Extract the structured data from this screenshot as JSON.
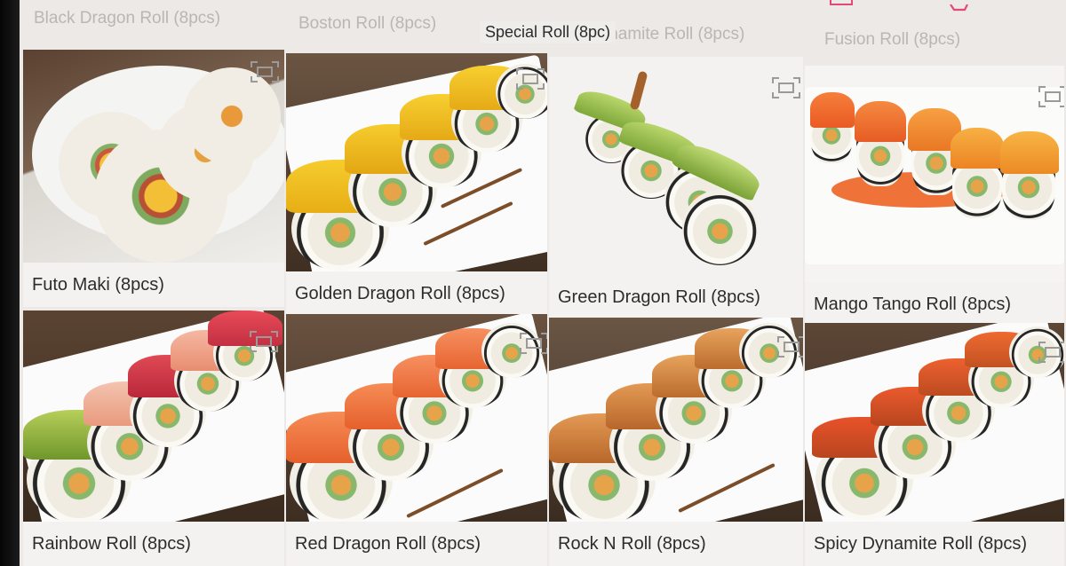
{
  "menu": {
    "top_categories": [
      "Black Dragon Roll (8pcs)",
      "Boston Roll (8pcs)",
      "Special Roll (8pc)",
      "Dynamite Roll (8pcs)",
      "Fusion Roll (8pcs)"
    ],
    "active_category": "Special Roll (8pc)",
    "items": [
      {
        "name": "Futo Maki (8pcs)"
      },
      {
        "name": "Golden Dragon Roll (8pcs)"
      },
      {
        "name": "Green Dragon Roll (8pcs)"
      },
      {
        "name": "Mango Tango Roll (8pcs)"
      },
      {
        "name": "Rainbow Roll (8pcs)"
      },
      {
        "name": "Red Dragon Roll (8pcs)"
      },
      {
        "name": "Rock N Roll (8pcs)"
      },
      {
        "name": "Spicy Dynamite Roll (8pcs)"
      }
    ]
  },
  "icons": {
    "expand": "expand-icon",
    "top_right": "cart-icon"
  },
  "colors": {
    "accent": "#e24a74",
    "caption_text": "#2c2c2c",
    "faded_text": "#b9b7b3"
  }
}
